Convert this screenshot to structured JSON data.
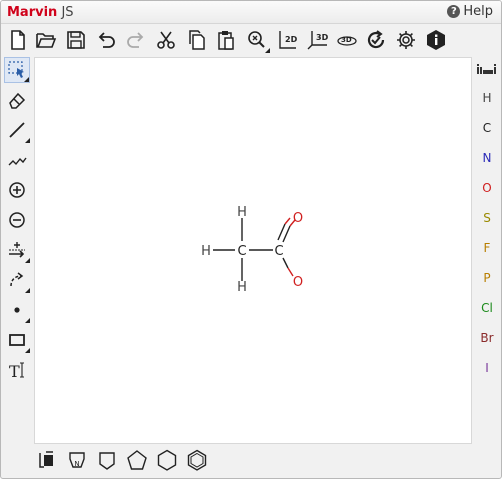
{
  "app": {
    "brand_main": "Marvin",
    "brand_sub": "JS",
    "help_label": "Help"
  },
  "toolbar": [
    {
      "name": "new-document-icon"
    },
    {
      "name": "open-folder-icon"
    },
    {
      "name": "save-icon"
    },
    {
      "name": "undo-icon"
    },
    {
      "name": "redo-icon"
    },
    {
      "name": "cut-icon"
    },
    {
      "name": "copy-icon"
    },
    {
      "name": "paste-icon"
    },
    {
      "name": "zoom-icon"
    },
    {
      "name": "clean-2d-icon",
      "label": "2D"
    },
    {
      "name": "clean-3d-icon",
      "label": "3D"
    },
    {
      "name": "3d-view-icon",
      "label": "3D"
    },
    {
      "name": "check-structure-icon"
    },
    {
      "name": "settings-gear-icon"
    },
    {
      "name": "info-icon"
    }
  ],
  "left_tools": [
    {
      "name": "rectangle-select-icon"
    },
    {
      "name": "eraser-icon"
    },
    {
      "name": "single-bond-icon"
    },
    {
      "name": "chain-icon"
    },
    {
      "name": "positive-charge-icon"
    },
    {
      "name": "negative-charge-icon"
    },
    {
      "name": "reaction-arrow-icon"
    },
    {
      "name": "electron-flow-icon"
    },
    {
      "name": "radical-dot-icon"
    },
    {
      "name": "rectangle-shape-icon"
    },
    {
      "name": "text-tool-icon",
      "label": "T"
    }
  ],
  "periodic_table_icon": "periodic-table-icon",
  "elements": [
    {
      "symbol": "H",
      "color": "#444444"
    },
    {
      "symbol": "C",
      "color": "#222222"
    },
    {
      "symbol": "N",
      "color": "#2b2bb8"
    },
    {
      "symbol": "O",
      "color": "#d01f1f"
    },
    {
      "symbol": "S",
      "color": "#9a8a00"
    },
    {
      "symbol": "F",
      "color": "#b87e00"
    },
    {
      "symbol": "P",
      "color": "#b87e00"
    },
    {
      "symbol": "Cl",
      "color": "#1a8a1a"
    },
    {
      "symbol": "Br",
      "color": "#8a2a2a"
    },
    {
      "symbol": "I",
      "color": "#7a3a9a"
    }
  ],
  "bottom_tools": [
    {
      "name": "template-library-icon"
    },
    {
      "name": "peptide-template-icon",
      "label": "N"
    },
    {
      "name": "cyclobutane-icon"
    },
    {
      "name": "cyclopentane-icon"
    },
    {
      "name": "cyclohexane-icon"
    },
    {
      "name": "benzene-icon"
    }
  ],
  "molecule": {
    "atoms": [
      {
        "id": "C1",
        "label": "C",
        "color": "#222222"
      },
      {
        "id": "C2",
        "label": "C",
        "color": "#222222"
      },
      {
        "id": "H1",
        "label": "H",
        "color": "#444444"
      },
      {
        "id": "H2",
        "label": "H",
        "color": "#444444"
      },
      {
        "id": "H3",
        "label": "H",
        "color": "#444444"
      },
      {
        "id": "O1",
        "label": "O",
        "color": "#d01f1f"
      },
      {
        "id": "O2",
        "label": "O",
        "color": "#d01f1f"
      }
    ],
    "bonds": [
      {
        "from": "C1",
        "to": "C2",
        "order": 1
      },
      {
        "from": "C1",
        "to": "H1",
        "order": 1
      },
      {
        "from": "C1",
        "to": "H2",
        "order": 1
      },
      {
        "from": "C1",
        "to": "H3",
        "order": 1
      },
      {
        "from": "C2",
        "to": "O1",
        "order": 2
      },
      {
        "from": "C2",
        "to": "O2",
        "order": 1
      }
    ]
  }
}
